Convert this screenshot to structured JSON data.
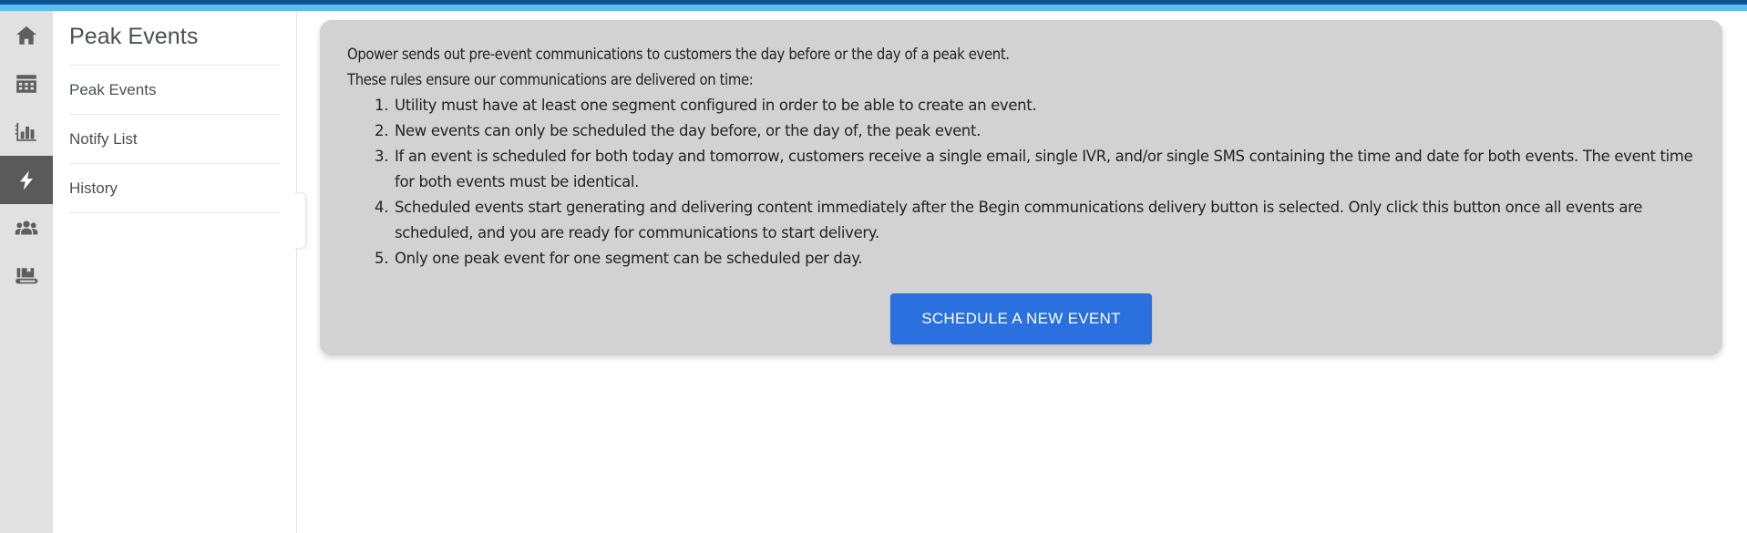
{
  "chrome": {
    "topbar_primary_color": "#0d5494",
    "topbar_secondary_color": "#5cbcf3"
  },
  "rail": {
    "items": [
      {
        "name": "home-icon",
        "label": "Home",
        "active": false
      },
      {
        "name": "calendar-icon",
        "label": "Calendar",
        "active": false
      },
      {
        "name": "bar-chart-icon",
        "label": "Reports",
        "active": false
      },
      {
        "name": "lightning-bolt-icon",
        "label": "Peak Events",
        "active": true
      },
      {
        "name": "people-group-icon",
        "label": "Customers",
        "active": false
      },
      {
        "name": "book-icon",
        "label": "Library",
        "active": false
      }
    ]
  },
  "nav": {
    "title": "Peak Events",
    "links": [
      {
        "label": "Peak Events"
      },
      {
        "label": "Notify List"
      },
      {
        "label": "History"
      }
    ]
  },
  "card": {
    "intro": [
      "Opower sends out pre-event communications to customers the day before or the day of a peak event.",
      "These rules ensure our communications are delivered on time:"
    ],
    "rules": [
      "Utility must have at least one segment configured in order to be able to create an event.",
      "New events can only be scheduled the day before, or the day of, the peak event.",
      "If an event is scheduled for both today and tomorrow, customers receive a single email, single IVR, and/or single SMS containing the time and date for both events. The event time for both events must be identical.",
      "Scheduled events start generating and delivering content immediately after the Begin communications delivery button is selected. Only click this button once all events are scheduled, and you are ready for communications to start delivery.",
      "Only one peak event for one segment can be scheduled per day."
    ],
    "primary_button": "SCHEDULE A NEW EVENT",
    "primary_button_color": "#2a70de",
    "background_color": "#d2d2d2"
  }
}
